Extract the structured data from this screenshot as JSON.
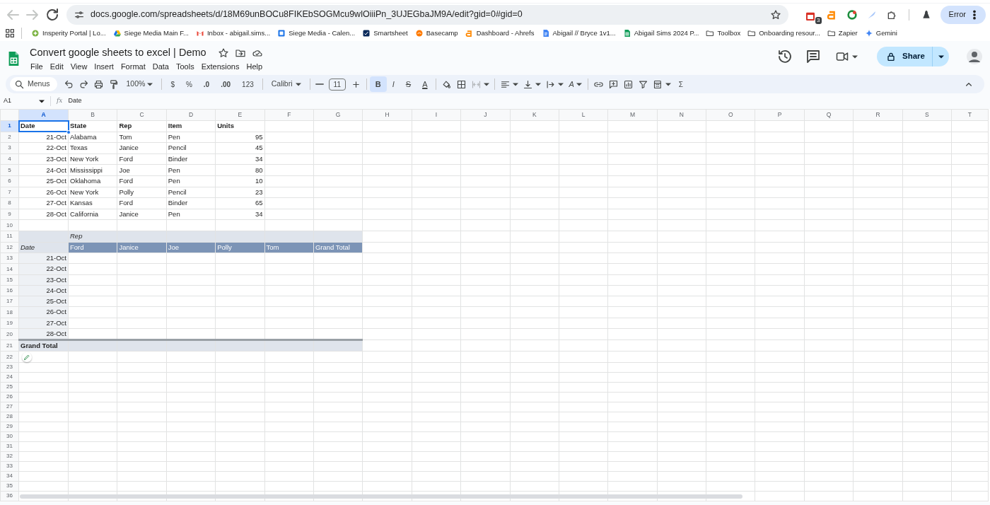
{
  "browser": {
    "url": "docs.google.com/spreadsheets/d/18M69unBOCu8FIKEbSOGMcu9wlOiiiPn_3UJEGbaJM9A/edit?gid=0#gid=0",
    "extension_badge": "3",
    "profile_label": "Error",
    "bookmarks": [
      {
        "label": "Insperity Portal | Lo...",
        "kind": "site"
      },
      {
        "label": "Siege Media Main F...",
        "kind": "site"
      },
      {
        "label": "Inbox - abigail.sims...",
        "kind": "site"
      },
      {
        "label": "Siege Media - Calen...",
        "kind": "site"
      },
      {
        "label": "Smartsheet",
        "kind": "site"
      },
      {
        "label": "Basecamp",
        "kind": "site"
      },
      {
        "label": "Dashboard - Ahrefs",
        "kind": "site"
      },
      {
        "label": "Abigail // Bryce 1v1...",
        "kind": "site"
      },
      {
        "label": "Abigail Sims 2024 P...",
        "kind": "site"
      },
      {
        "label": "Toolbox",
        "kind": "folder"
      },
      {
        "label": "Onboarding resour...",
        "kind": "folder"
      },
      {
        "label": "Zapier",
        "kind": "folder"
      },
      {
        "label": "Gemini",
        "kind": "site"
      }
    ]
  },
  "document": {
    "title": "Convert google sheets to excel | Demo",
    "menus": [
      "File",
      "Edit",
      "View",
      "Insert",
      "Format",
      "Data",
      "Tools",
      "Extensions",
      "Help"
    ],
    "share": "Share"
  },
  "toolbar": [
    {
      "kind": "search",
      "label": "Menus"
    },
    {
      "kind": "undo"
    },
    {
      "kind": "redo"
    },
    {
      "kind": "print"
    },
    {
      "kind": "painter"
    },
    {
      "kind": "dropdown",
      "label": "100%"
    },
    {
      "kind": "separator"
    },
    {
      "kind": "text",
      "label": "$"
    },
    {
      "kind": "text",
      "label": "%"
    },
    {
      "kind": "decless",
      "label": ".0"
    },
    {
      "kind": "decmore",
      "label": ".00"
    },
    {
      "kind": "text",
      "label": "123"
    },
    {
      "kind": "separator"
    },
    {
      "kind": "font",
      "label": "Calibri"
    },
    {
      "kind": "separator"
    },
    {
      "kind": "minus"
    },
    {
      "kind": "size",
      "label": "11"
    },
    {
      "kind": "plus"
    },
    {
      "kind": "separator"
    },
    {
      "kind": "bold",
      "label": "B",
      "on": true
    },
    {
      "kind": "italic",
      "label": "I",
      "on": false
    },
    {
      "kind": "strike",
      "label": "S",
      "on": false
    },
    {
      "kind": "textcolor",
      "label": "A"
    },
    {
      "kind": "separator"
    },
    {
      "kind": "fill"
    },
    {
      "kind": "borders"
    },
    {
      "kind": "merge"
    },
    {
      "kind": "separator"
    },
    {
      "kind": "align"
    },
    {
      "kind": "valign"
    },
    {
      "kind": "wrap"
    },
    {
      "kind": "rotate",
      "label": "A"
    },
    {
      "kind": "separator"
    },
    {
      "kind": "link"
    },
    {
      "kind": "comment"
    },
    {
      "kind": "chart"
    },
    {
      "kind": "filter"
    },
    {
      "kind": "table"
    },
    {
      "kind": "text",
      "label": "Σ"
    }
  ],
  "formula_bar": {
    "name_box": "A1",
    "label": "fx",
    "formula": "Date"
  },
  "grid": {
    "columns": [
      {
        "label": "A",
        "selected": true
      },
      {
        "label": "B",
        "selected": false
      },
      {
        "label": "C",
        "selected": false
      },
      {
        "label": "D",
        "selected": false
      },
      {
        "label": "E",
        "selected": false
      },
      {
        "label": "F",
        "selected": false
      },
      {
        "label": "G",
        "selected": false
      },
      {
        "label": "H",
        "selected": false
      },
      {
        "label": "I",
        "selected": false
      },
      {
        "label": "J",
        "selected": false
      },
      {
        "label": "K",
        "selected": false
      },
      {
        "label": "L",
        "selected": false
      },
      {
        "label": "M",
        "selected": false
      },
      {
        "label": "N",
        "selected": false
      },
      {
        "label": "O",
        "selected": false
      },
      {
        "label": "P",
        "selected": false
      },
      {
        "label": "Q",
        "selected": false
      },
      {
        "label": "R",
        "selected": false
      },
      {
        "label": "S",
        "selected": false
      },
      {
        "label": "T",
        "selected": false
      }
    ],
    "rows": [
      {
        "label": "1",
        "selected": true,
        "kind": "header",
        "cells": [
          "Date",
          "State",
          "Rep",
          "Item",
          "Units"
        ]
      },
      {
        "label": "2",
        "selected": false,
        "kind": "data",
        "cells": [
          "21-Oct",
          "Alabama",
          "Tom",
          "Pen",
          "95"
        ]
      },
      {
        "label": "3",
        "selected": false,
        "kind": "data",
        "cells": [
          "22-Oct",
          "Texas",
          "Janice",
          "Pencil",
          "45"
        ]
      },
      {
        "label": "4",
        "selected": false,
        "kind": "data",
        "cells": [
          "23-Oct",
          "New York",
          "Ford",
          "Binder",
          "34"
        ]
      },
      {
        "label": "5",
        "selected": false,
        "kind": "data",
        "cells": [
          "24-Oct",
          "Mississippi",
          "Joe",
          "Pen",
          "80"
        ]
      },
      {
        "label": "6",
        "selected": false,
        "kind": "data",
        "cells": [
          "25-Oct",
          "Oklahoma",
          "Ford",
          "Pen",
          "10"
        ]
      },
      {
        "label": "7",
        "selected": false,
        "kind": "data",
        "cells": [
          "26-Oct",
          "New York",
          "Polly",
          "Pencil",
          "23"
        ]
      },
      {
        "label": "8",
        "selected": false,
        "kind": "data",
        "cells": [
          "27-Oct",
          "Kansas",
          "Ford",
          "Binder",
          "65"
        ]
      },
      {
        "label": "9",
        "selected": false,
        "kind": "data",
        "cells": [
          "28-Oct",
          "California",
          "Janice",
          "Pen",
          "34"
        ]
      },
      {
        "label": "10",
        "selected": false,
        "kind": "empty"
      },
      {
        "label": "11",
        "selected": false,
        "kind": "pivotcols",
        "cells": [
          "Rep"
        ]
      },
      {
        "label": "12",
        "selected": false,
        "kind": "pivothead",
        "cells": [
          "Date",
          "Ford",
          "Janice",
          "Joe",
          "Polly",
          "Tom",
          "Grand Total"
        ]
      },
      {
        "label": "13",
        "selected": false,
        "kind": "pivotrow",
        "cells": [
          "21-Oct"
        ]
      },
      {
        "label": "14",
        "selected": false,
        "kind": "pivotrow",
        "cells": [
          "22-Oct"
        ]
      },
      {
        "label": "15",
        "selected": false,
        "kind": "pivotrow",
        "cells": [
          "23-Oct"
        ]
      },
      {
        "label": "16",
        "selected": false,
        "kind": "pivotrow",
        "cells": [
          "24-Oct"
        ]
      },
      {
        "label": "17",
        "selected": false,
        "kind": "pivotrow",
        "cells": [
          "25-Oct"
        ]
      },
      {
        "label": "18",
        "selected": false,
        "kind": "pivotrow",
        "cells": [
          "26-Oct"
        ]
      },
      {
        "label": "19",
        "selected": false,
        "kind": "pivotrow",
        "cells": [
          "27-Oct"
        ]
      },
      {
        "label": "20",
        "selected": false,
        "kind": "pivotrow",
        "cells": [
          "28-Oct"
        ]
      },
      {
        "label": "21",
        "selected": false,
        "kind": "pivottotal",
        "cells": [
          "Grand Total"
        ]
      },
      {
        "label": "22",
        "selected": false,
        "kind": "empty"
      },
      {
        "label": "23",
        "selected": false,
        "kind": "empty"
      },
      {
        "label": "24",
        "selected": false,
        "kind": "empty"
      },
      {
        "label": "25",
        "selected": false,
        "kind": "empty"
      },
      {
        "label": "26",
        "selected": false,
        "kind": "empty"
      },
      {
        "label": "27",
        "selected": false,
        "kind": "empty"
      },
      {
        "label": "28",
        "selected": false,
        "kind": "empty"
      },
      {
        "label": "29",
        "selected": false,
        "kind": "empty"
      },
      {
        "label": "30",
        "selected": false,
        "kind": "empty"
      },
      {
        "label": "31",
        "selected": false,
        "kind": "empty"
      },
      {
        "label": "32",
        "selected": false,
        "kind": "empty"
      },
      {
        "label": "33",
        "selected": false,
        "kind": "empty"
      },
      {
        "label": "34",
        "selected": false,
        "kind": "empty"
      },
      {
        "label": "35",
        "selected": false,
        "kind": "empty"
      },
      {
        "label": "36",
        "selected": false,
        "kind": "empty"
      }
    ]
  }
}
